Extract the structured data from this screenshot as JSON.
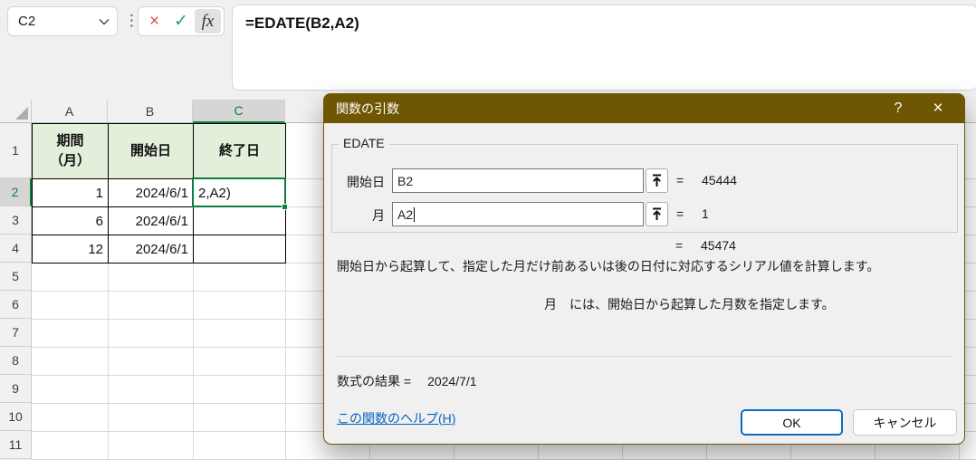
{
  "colors": {
    "accent_green": "#107C41",
    "header_fill": "#E2EFDA",
    "dialog_title_bg": "#6F5603",
    "link_blue": "#0563C1",
    "ok_border_blue": "#0F6CBD",
    "cancel_icon_red": "#D9534F",
    "enter_icon_green": "#21A366"
  },
  "name_box": {
    "value": "C2"
  },
  "formula_bar": {
    "menu_dots": "⋮",
    "cancel_icon": "×",
    "enter_icon": "✓",
    "fx_icon": "fx",
    "formula": "=EDATE(B2,A2)"
  },
  "sheet": {
    "col_headers": [
      "A",
      "B",
      "C"
    ],
    "row_headers": [
      "1",
      "2",
      "3",
      "4",
      "5",
      "6",
      "7",
      "8",
      "9",
      "10",
      "11"
    ],
    "table": {
      "headers": {
        "a_line1": "期間",
        "a_line2": "（月）",
        "b": "開始日",
        "c": "終了日"
      },
      "rows": [
        {
          "a": "1",
          "b": "2024/6/1",
          "c": "2,A2)"
        },
        {
          "a": "6",
          "b": "2024/6/1",
          "c": ""
        },
        {
          "a": "12",
          "b": "2024/6/1",
          "c": ""
        }
      ]
    }
  },
  "dialog": {
    "title": "関数の引数",
    "help_icon": "?",
    "close_icon": "×",
    "function_name": "EDATE",
    "args": [
      {
        "label": "開始日",
        "value": "B2",
        "equals": "=",
        "result": "45444"
      },
      {
        "label": "月",
        "value": "A2",
        "equals": "=",
        "result": "1"
      }
    ],
    "overall": {
      "equals": "=",
      "result": "45474"
    },
    "description": "開始日から起算して、指定した月だけ前あるいは後の日付に対応するシリアル値を計算します。",
    "arg_description": "月　には、開始日から起算した月数を指定します。",
    "result_label": "数式の結果 =",
    "result_value": "2024/7/1",
    "help_link": "この関数のヘルプ(H)",
    "ok_label": "OK",
    "cancel_label": "キャンセル"
  }
}
